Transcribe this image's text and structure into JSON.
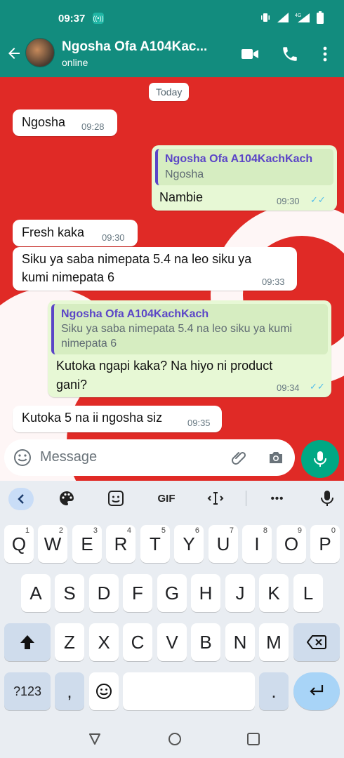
{
  "status_bar": {
    "time": "09:37"
  },
  "header": {
    "contact_name": "Ngosha Ofa A104Kac...",
    "status": "online",
    "bg_color": "#128C7E"
  },
  "chat": {
    "day_chip": "Today",
    "messages": [
      {
        "direction": "incoming",
        "text": "Ngosha",
        "time": "09:28"
      },
      {
        "direction": "outgoing",
        "quote_author": "Ngosha Ofa A104KachKach",
        "quote_text": "Ngosha",
        "text": "Nambie",
        "time": "09:30",
        "status": "read"
      },
      {
        "direction": "incoming",
        "text": "Fresh kaka",
        "time": "09:30"
      },
      {
        "direction": "incoming",
        "text_line1": "Siku ya saba nimepata 5.4 na leo siku ya",
        "text_line2": "kumi nimepata 6",
        "time": "09:33"
      },
      {
        "direction": "outgoing",
        "quote_author": "Ngosha Ofa A104KachKach",
        "quote_line1": "Siku ya saba nimepata 5.4 na leo siku ya kumi",
        "quote_line2": "nimepata 6",
        "text_line1": "Kutoka ngapi kaka? Na hiyo ni product",
        "text_line2": "gani?",
        "time": "09:34",
        "status": "read"
      },
      {
        "direction": "incoming",
        "text": "Kutoka 5 na ii ngosha siz",
        "time": "09:35"
      }
    ]
  },
  "composer": {
    "placeholder": "Message"
  },
  "keyboard": {
    "toolbar": [
      "back-chevron",
      "palette",
      "sticker",
      "GIF",
      "cursor",
      "more",
      "mic"
    ],
    "gif_label": "GIF",
    "more_label": "•••",
    "row1": [
      {
        "k": "Q",
        "h": "1"
      },
      {
        "k": "W",
        "h": "2"
      },
      {
        "k": "E",
        "h": "3"
      },
      {
        "k": "R",
        "h": "4"
      },
      {
        "k": "T",
        "h": "5"
      },
      {
        "k": "Y",
        "h": "6"
      },
      {
        "k": "U",
        "h": "7"
      },
      {
        "k": "I",
        "h": "8"
      },
      {
        "k": "O",
        "h": "9"
      },
      {
        "k": "P",
        "h": "0"
      }
    ],
    "row2": [
      "A",
      "S",
      "D",
      "F",
      "G",
      "H",
      "J",
      "K",
      "L"
    ],
    "row3": [
      "Z",
      "X",
      "C",
      "V",
      "B",
      "N",
      "M"
    ],
    "symbols_key": "?123",
    "comma_key": ",",
    "period_key": ".",
    "accent_color": "#a8d4f7"
  }
}
